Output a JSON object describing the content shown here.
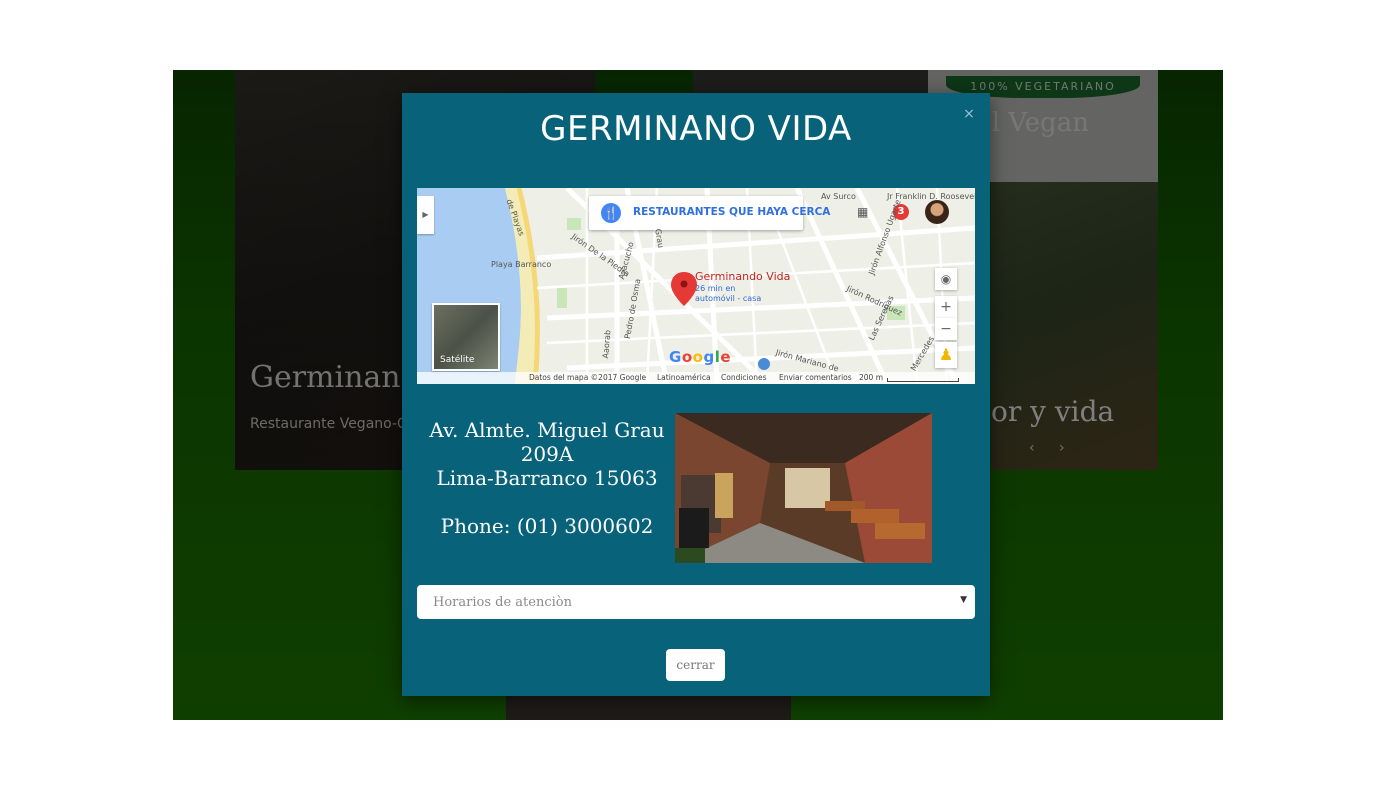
{
  "background": {
    "card1": {
      "title": "Germinando V",
      "subtitle": "Restaurante Vegano-Click"
    },
    "card3": {
      "ribbon": "100% VEGETARIANO",
      "name": "iel Vegan"
    },
    "card4": {
      "caption": "or y vida",
      "arrows": "‹ ›"
    }
  },
  "modal": {
    "title": "GERMINANO VIDA",
    "close_icon": "×",
    "map": {
      "search_label": "RESTAURANTES QUE HAYA CERCA",
      "badge_count": "3",
      "place_name": "Germinando Vida",
      "eta_line1": "26 min en",
      "eta_line2": "automóvil - casa",
      "satellite_label": "Satélite",
      "labels": {
        "playa": "Playa Barranco",
        "dePlayas": "de Playas",
        "avSurco": "Av Surco",
        "roosevelt": "Jr Franklin D. Roosevelt",
        "pedro": "Pedro de Osma",
        "ayacucho": "Ayacucho",
        "grau": "Grau",
        "jironMariano": "Jirón Mariano de",
        "mercedes": "Mercedes",
        "jironRodriguez": "Jirón Rodríguez",
        "lasSerenas": "Las Serenas",
        "jironAlfonso": "Jirón Alfonso Ugarte",
        "jironDeLaPiedra": "Jirón De la Piedra",
        "aaorab": "Aaorab"
      },
      "google_letters": [
        "G",
        "o",
        "o",
        "g",
        "l",
        "e"
      ],
      "google_colors": [
        "#4285f4",
        "#ea4335",
        "#fbbc05",
        "#4285f4",
        "#34a853",
        "#ea4335"
      ],
      "footer": {
        "data": "Datos del mapa ©2017 Google",
        "region": "Latinoamérica",
        "terms": "Condiciones",
        "report": "Enviar comentarios",
        "scale": "200 m"
      }
    },
    "address": {
      "line1": "Av. Almte. Miguel Grau 209A",
      "line2": "Lima-Barranco 15063",
      "phone": "Phone: (01) 3000602"
    },
    "schedule_select": {
      "placeholder": "Horarios de atenciòn"
    },
    "close_button": "cerrar"
  },
  "colors": {
    "modal_bg": "#08627a",
    "page_bg": "#1a6e00",
    "water": "#a9cdf2",
    "beach": "#f4ecb7",
    "pin": "#e53935"
  }
}
